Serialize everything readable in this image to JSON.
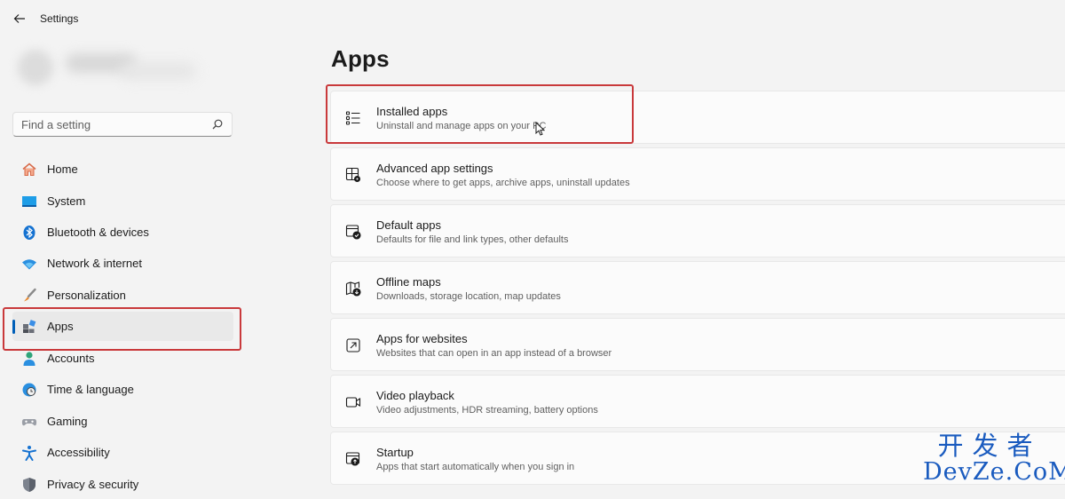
{
  "window": {
    "title": "Settings"
  },
  "search": {
    "placeholder": "Find a setting"
  },
  "sidebar": {
    "items": [
      {
        "label": "Home",
        "icon": "home-icon"
      },
      {
        "label": "System",
        "icon": "monitor-icon"
      },
      {
        "label": "Bluetooth & devices",
        "icon": "bluetooth-icon"
      },
      {
        "label": "Network & internet",
        "icon": "wifi-icon"
      },
      {
        "label": "Personalization",
        "icon": "paintbrush-icon"
      },
      {
        "label": "Apps",
        "icon": "apps-icon",
        "selected": true
      },
      {
        "label": "Accounts",
        "icon": "person-icon"
      },
      {
        "label": "Time & language",
        "icon": "globe-clock-icon"
      },
      {
        "label": "Gaming",
        "icon": "gamepad-icon"
      },
      {
        "label": "Accessibility",
        "icon": "accessibility-icon"
      },
      {
        "label": "Privacy & security",
        "icon": "shield-icon"
      }
    ]
  },
  "main": {
    "title": "Apps",
    "cards": [
      {
        "title": "Installed apps",
        "subtitle": "Uninstall and manage apps on your PC",
        "icon": "list-icon"
      },
      {
        "title": "Advanced app settings",
        "subtitle": "Choose where to get apps, archive apps, uninstall updates",
        "icon": "app-settings-icon"
      },
      {
        "title": "Default apps",
        "subtitle": "Defaults for file and link types, other defaults",
        "icon": "default-apps-icon"
      },
      {
        "title": "Offline maps",
        "subtitle": "Downloads, storage location, map updates",
        "icon": "map-download-icon"
      },
      {
        "title": "Apps for websites",
        "subtitle": "Websites that can open in an app instead of a browser",
        "icon": "open-in-app-icon"
      },
      {
        "title": "Video playback",
        "subtitle": "Video adjustments, HDR streaming, battery options",
        "icon": "video-icon"
      },
      {
        "title": "Startup",
        "subtitle": "Apps that start automatically when you sign in",
        "icon": "startup-icon"
      }
    ]
  },
  "watermark": {
    "line1": "开发者",
    "line2": "DevZe.CoM"
  },
  "colors": {
    "accent": "#005fb8",
    "highlight": "#c9393b",
    "watermark": "#1a5bbf"
  }
}
